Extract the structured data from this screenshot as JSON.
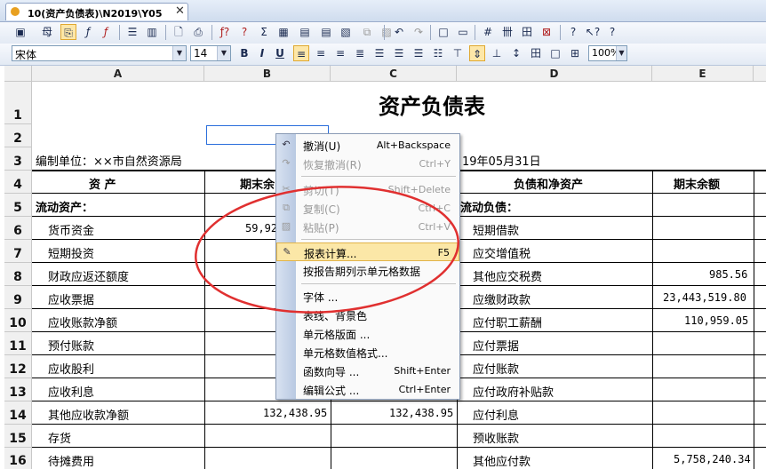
{
  "tab": {
    "title": "10(资产负债表)\\N2019\\Y05",
    "close": "✕"
  },
  "toolbar1": {
    "icons": [
      "save-icon",
      "preview-icon",
      "format-icon",
      "fx-icon",
      "fx-check-icon",
      "row-icon",
      "col-icon",
      "print-preview-icon",
      "print-icon",
      "audit-icon",
      "check-formula-icon",
      "sum-icon",
      "calc-icon",
      "grid-icon",
      "undo-icon",
      "redo-icon",
      "border-icon",
      "border2-icon",
      "hash-icon",
      "table-icon",
      "table2-icon",
      "cross-icon",
      "help-icon",
      "whatsthis-icon",
      "query-icon"
    ]
  },
  "toolbar2": {
    "font": "宋体",
    "size": "14",
    "zoom": "100%",
    "bold": "B",
    "italic": "I",
    "underline": "U"
  },
  "columns": [
    "A",
    "B",
    "C",
    "D",
    "E"
  ],
  "rows": [
    "1",
    "2",
    "3",
    "4",
    "5",
    "6",
    "7",
    "8",
    "9",
    "10",
    "11",
    "12",
    "13",
    "14",
    "15",
    "16"
  ],
  "sheet": {
    "title": "资产负债表",
    "unit": "编制单位：××市自然资源局",
    "date": "19年05月31日",
    "hdr_asset": "资    产",
    "hdr_balance_b": "期末余",
    "hdr_liab": "负债和净资产",
    "hdr_balance_e": "期末余额",
    "left_items": [
      "流动资产：",
      "货币资金",
      "短期投资",
      "财政应返还额度",
      "应收票据",
      "应收账款净额",
      "预付账款",
      "应收股利",
      "应收利息",
      "其他应收款净额",
      "存货",
      "待摊费用"
    ],
    "right_items": [
      "流动负债：",
      "短期借款",
      "应交增值税",
      "其他应交税费",
      "应缴财政款",
      "应付职工薪酬",
      "应付票据",
      "应付账款",
      "应付政府补贴款",
      "应付利息",
      "预收账款",
      "其他应付款"
    ],
    "b6": "59,92",
    "b14": "132,438.95",
    "c14": "132,438.95",
    "e8": "985.56",
    "e9": "23,443,519.80",
    "e10": "110,959.05",
    "e16": "5,758,240.34"
  },
  "menu": {
    "items": [
      {
        "label": "撤消(U)",
        "shortcut": "Alt+Backspace",
        "icon": "undo-icon",
        "disabled": false
      },
      {
        "label": "恢复撤消(R)",
        "shortcut": "Ctrl+Y",
        "icon": "redo-icon",
        "disabled": true
      },
      {
        "label": "剪切(T)",
        "shortcut": "Shift+Delete",
        "icon": "cut-icon",
        "disabled": true
      },
      {
        "label": "复制(C)",
        "shortcut": "Ctrl+C",
        "icon": "copy-icon",
        "disabled": true
      },
      {
        "label": "粘贴(P)",
        "shortcut": "Ctrl+V",
        "icon": "paste-icon",
        "disabled": true
      },
      {
        "label": "报表计算...",
        "shortcut": "F5",
        "icon": "calc-icon",
        "disabled": false
      },
      {
        "label": "按报告期列示单元格数据",
        "shortcut": "",
        "icon": "",
        "disabled": false
      },
      {
        "label": "字体 ...",
        "shortcut": "",
        "icon": "",
        "disabled": false
      },
      {
        "label": "表线、背景色",
        "shortcut": "",
        "icon": "",
        "disabled": false
      },
      {
        "label": "单元格版面 ...",
        "shortcut": "",
        "icon": "",
        "disabled": false
      },
      {
        "label": "单元格数值格式...",
        "shortcut": "",
        "icon": "",
        "disabled": false
      },
      {
        "label": "函数向导 ...",
        "shortcut": "Shift+Enter",
        "icon": "",
        "disabled": false
      },
      {
        "label": "编辑公式 ...",
        "shortcut": "Ctrl+Enter",
        "icon": "",
        "disabled": false
      }
    ]
  },
  "colors": {
    "annotation": "#e03030",
    "highlight": "#fbe7a7"
  }
}
